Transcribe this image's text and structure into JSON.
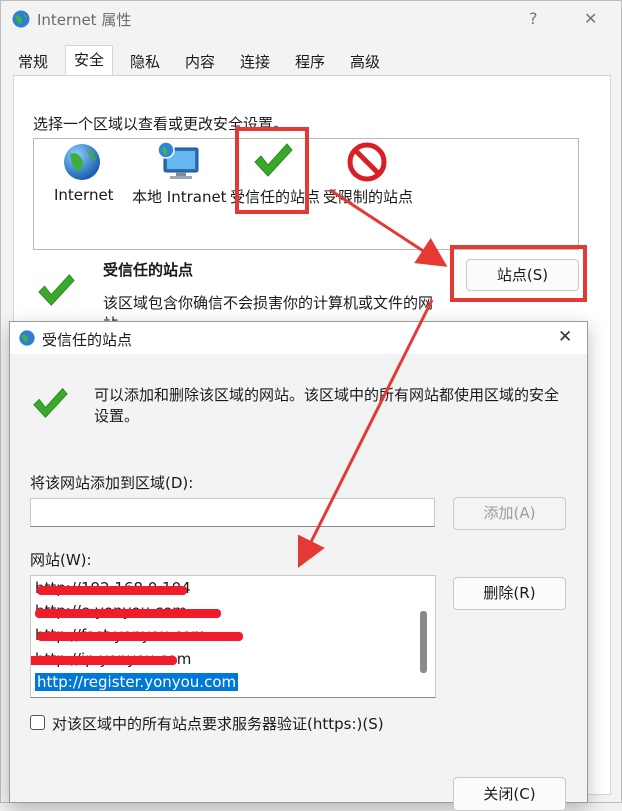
{
  "outer": {
    "title": "Internet 属性",
    "help": "?",
    "close": "✕",
    "tabs": [
      "常规",
      "安全",
      "隐私",
      "内容",
      "连接",
      "程序",
      "高级"
    ],
    "active_tab": "安全",
    "instruction": "选择一个区域以查看或更改安全设置。",
    "zones": [
      {
        "label": "Internet",
        "icon": "globe-icon"
      },
      {
        "label": "本地 Intranet",
        "icon": "intranet-monitor-icon"
      },
      {
        "label": "受信任的站点",
        "icon": "check-icon"
      },
      {
        "label": "受限制的站点",
        "icon": "restricted-icon"
      }
    ],
    "selected_zone_title": "受信任的站点",
    "selected_zone_desc": "该区域包含你确信不会损害你的计算机或文件的网",
    "selected_zone_desc2": "站。",
    "sites_button": "站点(S)"
  },
  "dialog": {
    "title": "受信任的站点",
    "close": "✕",
    "info": "可以添加和删除该区域的网站。该区域中的所有网站都使用区域的安全",
    "info2": "设置。",
    "add_label": "将该网站添加到区域(D):",
    "add_value": "",
    "add_button": "添加(A)",
    "sites_label": "网站(W):",
    "sites": [
      "http://192.168.0.104",
      "http://e.yonyou.com",
      "http://fast.yonyou.com",
      "http://ip.yonyou.com",
      "http://register.yonyou.com"
    ],
    "selected_site": "http://register.yonyou.com",
    "remove_button": "删除(R)",
    "https_checkbox": "对该区域中的所有站点要求服务器验证(https:)(S)",
    "https_checked": false,
    "close_button": "关闭(C)"
  },
  "colors": {
    "annotation_red": "#e53935",
    "selection_blue": "#0078d7",
    "check_green": "#3aa82b"
  }
}
